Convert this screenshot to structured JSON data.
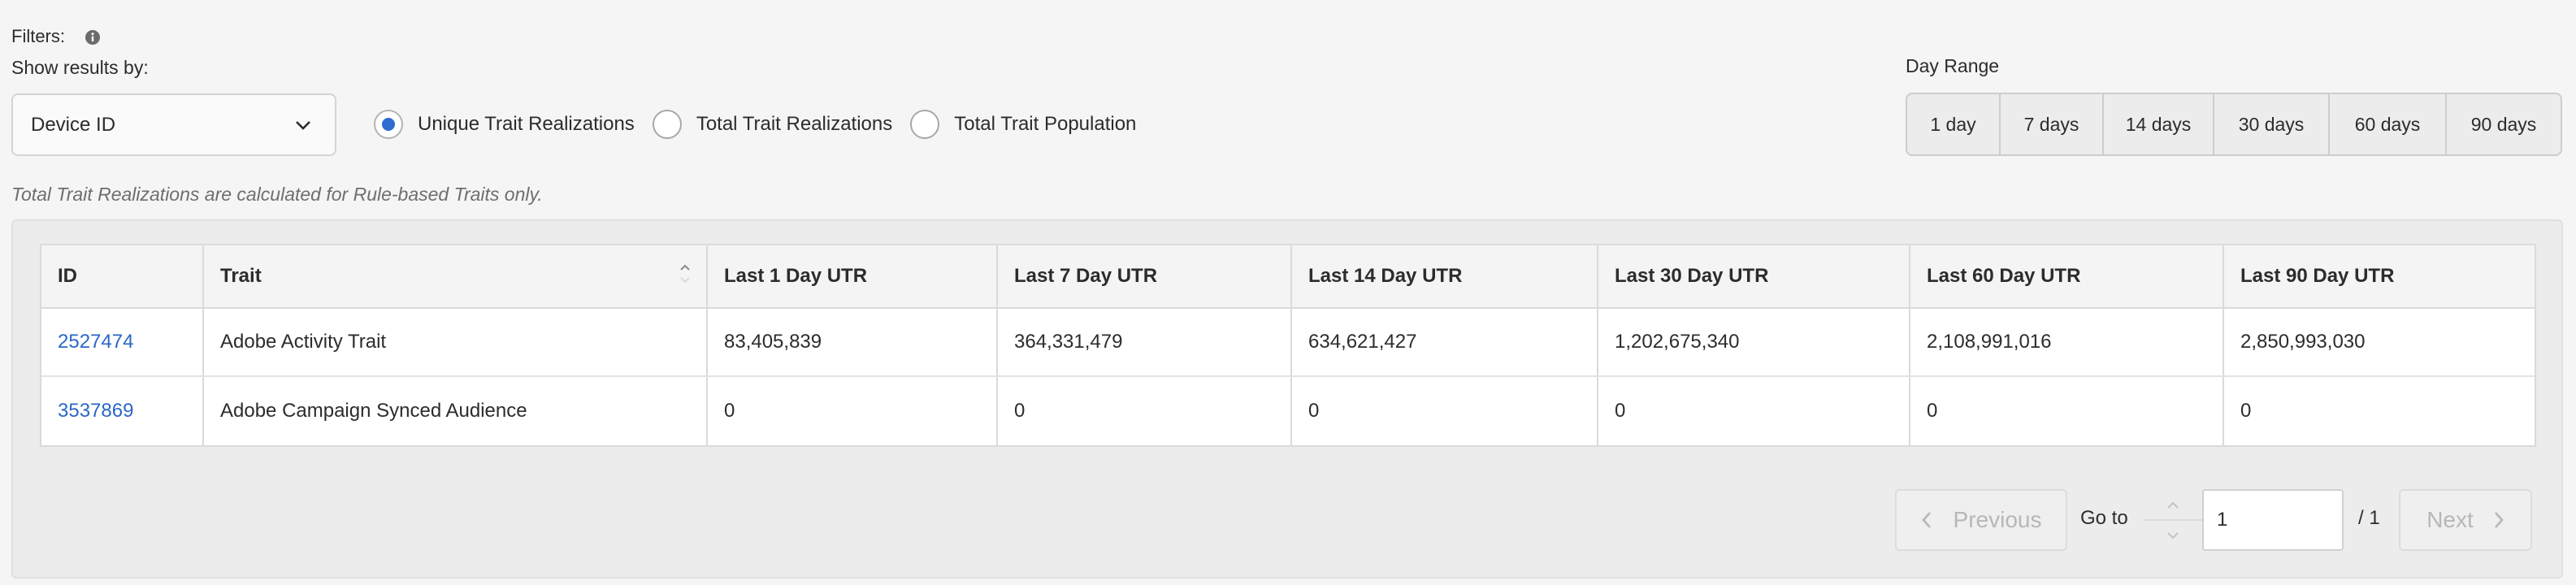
{
  "filters": {
    "label": "Filters:",
    "show_results_label": "Show results by:",
    "dropdown_value": "Device ID",
    "radios": [
      {
        "label": "Unique Trait Realizations",
        "checked": true
      },
      {
        "label": "Total Trait Realizations",
        "checked": false
      },
      {
        "label": "Total Trait Population",
        "checked": false
      }
    ],
    "note": "Total Trait Realizations are calculated for Rule-based Traits only."
  },
  "day_range": {
    "label": "Day Range",
    "options": [
      "1 day",
      "7 days",
      "14 days",
      "30 days",
      "60 days",
      "90 days"
    ]
  },
  "table": {
    "columns": [
      "ID",
      "Trait",
      "Last 1 Day UTR",
      "Last 7 Day UTR",
      "Last 14 Day UTR",
      "Last 30 Day UTR",
      "Last 60 Day UTR",
      "Last 90 Day UTR"
    ],
    "rows": [
      [
        "2527474",
        "Adobe Activity Trait",
        "83,405,839",
        "364,331,479",
        "634,621,427",
        "1,202,675,340",
        "2,108,991,016",
        "2,850,993,030"
      ],
      [
        "3537869",
        "Adobe Campaign Synced Audience",
        "0",
        "0",
        "0",
        "0",
        "0",
        "0"
      ]
    ]
  },
  "pagination": {
    "previous_label": "Previous",
    "goto_label": "Go to",
    "current_page": "1",
    "total_pages": "/ 1",
    "next_label": "Next"
  },
  "colors": {
    "link": "#2b67c6",
    "radio_selected": "#2d6bce",
    "disabled_text": "#b7b7b7"
  }
}
